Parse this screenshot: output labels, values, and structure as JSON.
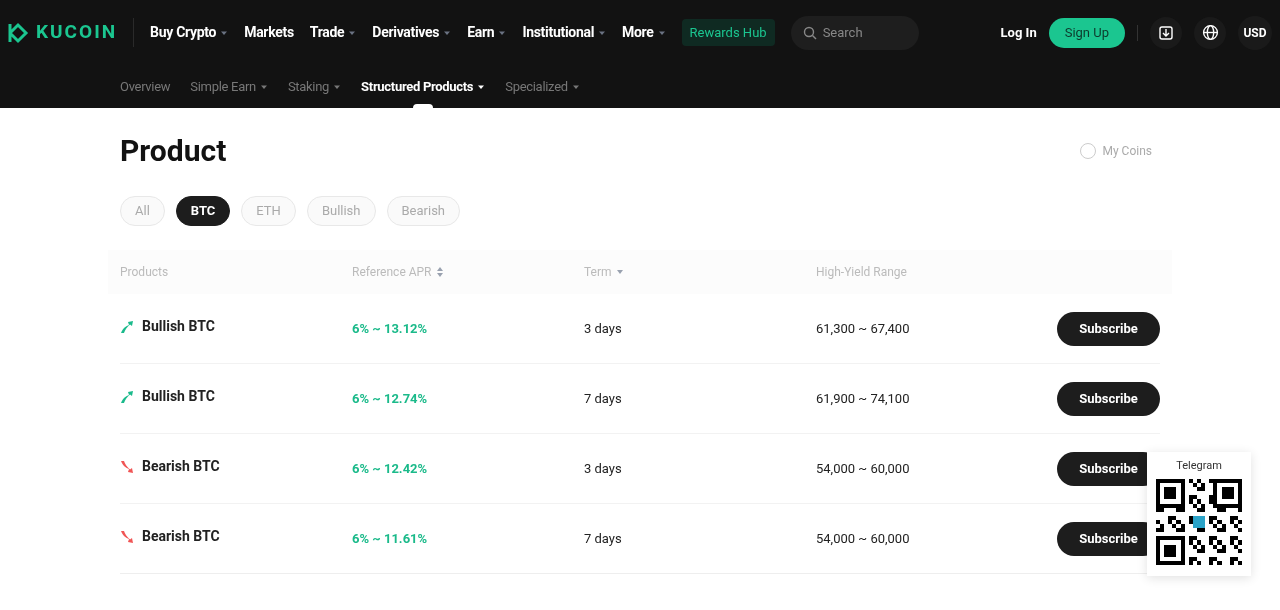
{
  "header": {
    "logo": "KUCOIN",
    "nav": [
      {
        "label": "Buy Crypto",
        "dropdown": true
      },
      {
        "label": "Markets",
        "dropdown": false
      },
      {
        "label": "Trade",
        "dropdown": true
      },
      {
        "label": "Derivatives",
        "dropdown": true
      },
      {
        "label": "Earn",
        "dropdown": true
      },
      {
        "label": "Institutional",
        "dropdown": true
      },
      {
        "label": "More",
        "dropdown": true
      }
    ],
    "rewards": "Rewards Hub",
    "search": {
      "placeholder": "Search"
    },
    "login": "Log In",
    "signup": "Sign Up",
    "currency": "USD"
  },
  "subnav": [
    {
      "label": "Overview",
      "dropdown": false,
      "selected": false
    },
    {
      "label": "Simple Earn",
      "dropdown": true,
      "selected": false
    },
    {
      "label": "Staking",
      "dropdown": true,
      "selected": false
    },
    {
      "label": "Structured Products",
      "dropdown": true,
      "selected": true
    },
    {
      "label": "Specialized",
      "dropdown": true,
      "selected": false
    }
  ],
  "title": "Product",
  "my_coins": {
    "label": "My Coins",
    "checked": false
  },
  "filters": [
    {
      "label": "All",
      "selected": false
    },
    {
      "label": "BTC",
      "selected": true
    },
    {
      "label": "ETH",
      "selected": false
    },
    {
      "label": "Bullish",
      "selected": false
    },
    {
      "label": "Bearish",
      "selected": false
    }
  ],
  "table": {
    "columns": [
      {
        "label": "Products",
        "kind": "plain"
      },
      {
        "label": "Reference APR",
        "kind": "sortable"
      },
      {
        "label": "Term",
        "kind": "dropdown"
      },
      {
        "label": "High-Yield Range",
        "kind": "plain"
      }
    ],
    "rows": [
      {
        "kind": "bullish",
        "product": "Bullish BTC",
        "apr": "6% ~ 13.12%",
        "term": "3 days",
        "range": "61,300 ~ 67,400",
        "action": "Subscribe"
      },
      {
        "kind": "bullish",
        "product": "Bullish BTC",
        "apr": "6% ~ 12.74%",
        "term": "7 days",
        "range": "61,900 ~ 74,100",
        "action": "Subscribe"
      },
      {
        "kind": "bearish",
        "product": "Bearish BTC",
        "apr": "6% ~ 12.42%",
        "term": "3 days",
        "range": "54,000 ~ 60,000",
        "action": "Subscribe"
      },
      {
        "kind": "bearish",
        "product": "Bearish BTC",
        "apr": "6% ~ 11.61%",
        "term": "7 days",
        "range": "54,000 ~ 60,000",
        "action": "Subscribe"
      }
    ]
  },
  "qr_popup": {
    "title": "Telegram"
  }
}
